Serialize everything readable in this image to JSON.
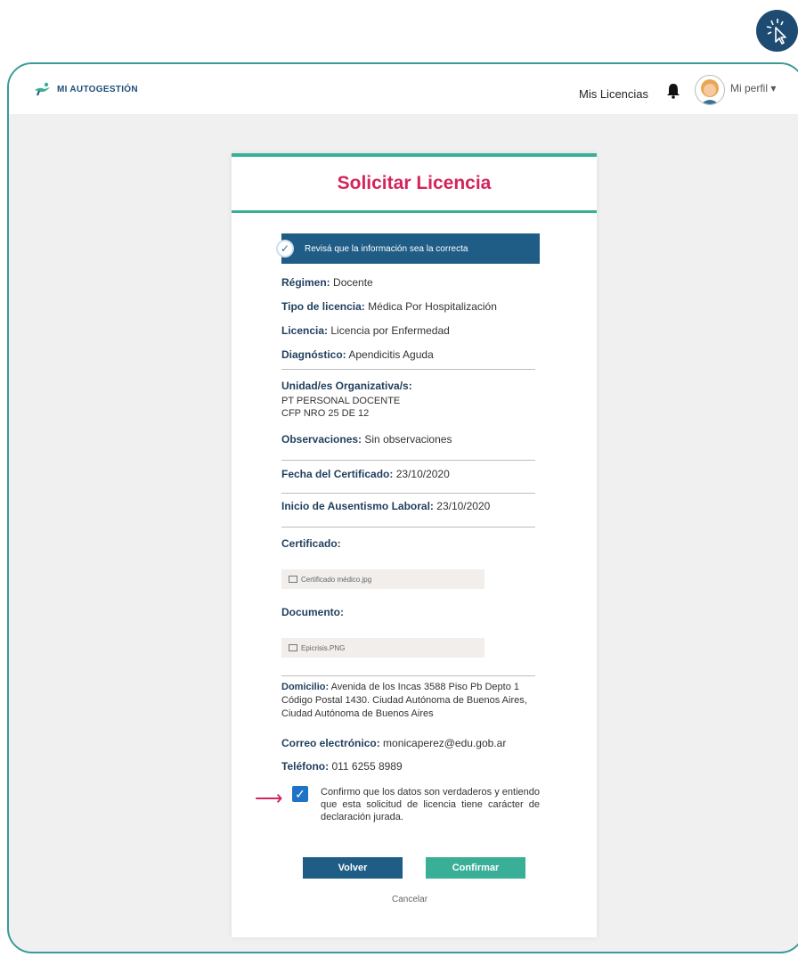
{
  "header": {
    "app_name": "MI AUTOGESTIÓN",
    "nav_licencias": "Mis Licencias",
    "profile_label": "Mi perfil ▾"
  },
  "card": {
    "title": "Solicitar Licencia",
    "banner": "Revisá que la información sea la correcta",
    "fields": {
      "regimen_label": "Régimen:",
      "regimen_value": "Docente",
      "tipo_label": "Tipo de licencia:",
      "tipo_value": "Médica Por Hospitalización",
      "licencia_label": "Licencia:",
      "licencia_value": "Licencia por Enfermedad",
      "diag_label": "Diagnóstico:",
      "diag_value": "Apendicitis Aguda",
      "unidad_label": "Unidad/es Organizativa/s:",
      "unidad_line1": "PT PERSONAL DOCENTE",
      "unidad_line2": "CFP NRO 25 DE 12",
      "obs_label": "Observaciones:",
      "obs_value": "Sin observaciones",
      "fecha_label": "Fecha del Certificado:",
      "fecha_value": "23/10/2020",
      "inicio_label": "Inicio de Ausentismo Laboral:",
      "inicio_value": "23/10/2020",
      "cert_label": "Certificado:",
      "cert_file": "Certificado médico.jpg",
      "doc_label": "Documento:",
      "doc_file": "Epicrisis.PNG",
      "domicilio_label": "Domicilio:",
      "domicilio_value": "Avenida de los Incas 3588 Piso Pb Depto 1 Código Postal 1430. Ciudad Autónoma de Buenos Aires, Ciudad Autónoma de Buenos Aires",
      "correo_label": "Correo electrónico:",
      "correo_value": "monicaperez@edu.gob.ar",
      "telefono_label": "Teléfono:",
      "telefono_value": "011 6255 8989"
    },
    "confirm_text": "Confirmo que los datos son verdaderos y entiendo que esta solicitud de licencia tiene carácter de declaración jurada.",
    "buttons": {
      "back": "Volver",
      "confirm": "Confirmar",
      "cancel": "Cancelar"
    }
  },
  "colors": {
    "accent_teal": "#3aaf98",
    "title_pink": "#d4245c",
    "navy": "#1f5c86"
  }
}
